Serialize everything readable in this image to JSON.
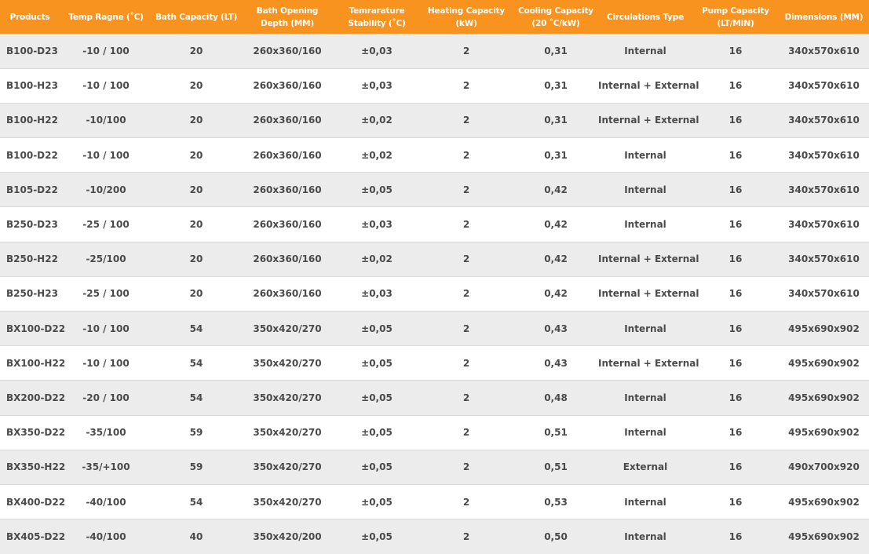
{
  "headers": [
    "Products",
    "Temp Ragne (˚C)",
    "Bath Capacity (LT)",
    "Bath Opening Depth (MM)",
    "Temrarature Stability (˚C)",
    "Heating Capacity (kW)",
    "Cooling Capacity (20 ˚C/kW)",
    "Circulations Type",
    "Pump Capacity (LT/MIN)",
    "Dimensions (MM)"
  ],
  "rows": [
    [
      "B100-D23",
      "-10 / 100",
      "20",
      "260x360/160",
      "±0,03",
      "2",
      "0,31",
      "Internal",
      "16",
      "340x570x610"
    ],
    [
      "B100-H23",
      "-10 / 100",
      "20",
      "260x360/160",
      "±0,03",
      "2",
      "0,31",
      "Internal + External",
      "16",
      "340x570x610"
    ],
    [
      "B100-H22",
      "-10/100",
      "20",
      "260x360/160",
      "±0,02",
      "2",
      "0,31",
      "Internal + External",
      "16",
      "340x570x610"
    ],
    [
      "B100-D22",
      "-10 / 100",
      "20",
      "260x360/160",
      "±0,02",
      "2",
      "0,31",
      "Internal",
      "16",
      "340x570x610"
    ],
    [
      "B105-D22",
      "-10/200",
      "20",
      "260x360/160",
      "±0,05",
      "2",
      "0,42",
      "Internal",
      "16",
      "340x570x610"
    ],
    [
      "B250-D23",
      "-25 / 100",
      "20",
      "260x360/160",
      "±0,03",
      "2",
      "0,42",
      "Internal",
      "16",
      "340x570x610"
    ],
    [
      "B250-H22",
      "-25/100",
      "20",
      "260x360/160",
      "±0,02",
      "2",
      "0,42",
      "Internal + External",
      "16",
      "340x570x610"
    ],
    [
      "B250-H23",
      "-25 / 100",
      "20",
      "260x360/160",
      "±0,03",
      "2",
      "0,42",
      "Internal + External",
      "16",
      "340x570x610"
    ],
    [
      "BX100-D22",
      "-10 / 100",
      "54",
      "350x420/270",
      "±0,05",
      "2",
      "0,43",
      "Internal",
      "16",
      "495x690x902"
    ],
    [
      "BX100-H22",
      "-10 / 100",
      "54",
      "350x420/270",
      "±0,05",
      "2",
      "0,43",
      "Internal + External",
      "16",
      "495x690x902"
    ],
    [
      "BX200-D22",
      "-20 / 100",
      "54",
      "350x420/270",
      "±0,05",
      "2",
      "0,48",
      "Internal",
      "16",
      "495x690x902"
    ],
    [
      "BX350-D22",
      "-35/100",
      "59",
      "350x420/270",
      "±0,05",
      "2",
      "0,51",
      "Internal",
      "16",
      "495x690x902"
    ],
    [
      "BX350-H22",
      "-35/+100",
      "59",
      "350x420/270",
      "±0,05",
      "2",
      "0,51",
      "External",
      "16",
      "490x700x920"
    ],
    [
      "BX400-D22",
      "-40/100",
      "54",
      "350x420/270",
      "±0,05",
      "2",
      "0,53",
      "Internal",
      "16",
      "495x690x902"
    ],
    [
      "BX405-D22",
      "-40/100",
      "40",
      "350x420/200",
      "±0,05",
      "2",
      "0,50",
      "Internal",
      "16",
      "495x690x902"
    ]
  ],
  "colors": {
    "header_bg": "#f7931e",
    "stripe_bg": "#ececec",
    "text": "#4a4a4a"
  }
}
